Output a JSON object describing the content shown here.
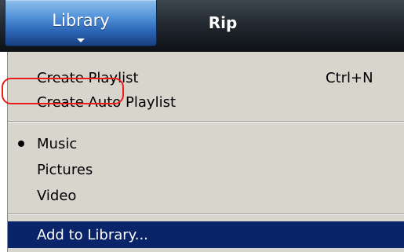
{
  "tabs": {
    "library": "Library",
    "rip": "Rip"
  },
  "menu": {
    "create_playlist": "Create Playlist",
    "create_playlist_shortcut": "Ctrl+N",
    "create_auto_playlist": "Create Auto Playlist",
    "music": "Music",
    "pictures": "Pictures",
    "video": "Video",
    "add_to_library": "Add to Library..."
  },
  "selected_media": "Music",
  "colors": {
    "annotation": "#ee1b1b",
    "selection": "#0a246a",
    "menu_background": "#d8d5cd"
  }
}
